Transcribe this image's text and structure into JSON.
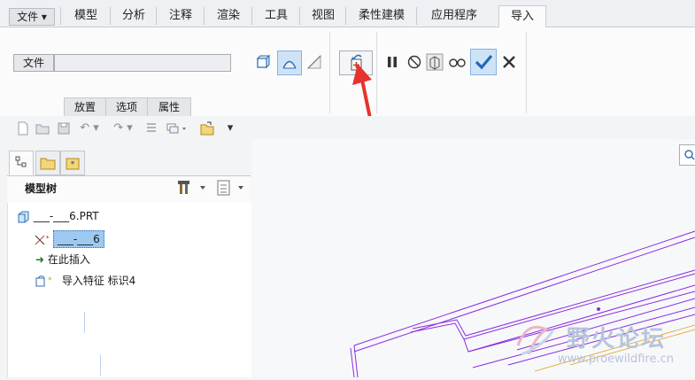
{
  "tabs": [
    {
      "label": "文件 ▾"
    },
    {
      "label": "模型"
    },
    {
      "label": "分析"
    },
    {
      "label": "注释"
    },
    {
      "label": "渲染"
    },
    {
      "label": "工具"
    },
    {
      "label": "视图"
    },
    {
      "label": "柔性建模"
    },
    {
      "label": "应用程序"
    },
    {
      "label": "导入"
    }
  ],
  "ribbon": {
    "file_button": "文件",
    "file_input_value": "",
    "sub_tabs": [
      "放置",
      "选项",
      "属性"
    ]
  },
  "panel": {
    "title": "模型树"
  },
  "tree": {
    "items": [
      {
        "label": "___-___6.PRT"
      },
      {
        "label": "___-___6"
      },
      {
        "label": "在此插入"
      },
      {
        "label": "导入特征 标识4"
      }
    ]
  },
  "watermark": {
    "title": "野火论坛",
    "url": "www.proewildfire.cn"
  },
  "colors": {
    "accent": "#2f7fd6",
    "arrow": "#e8322c",
    "geometry": "#8a2be2"
  }
}
